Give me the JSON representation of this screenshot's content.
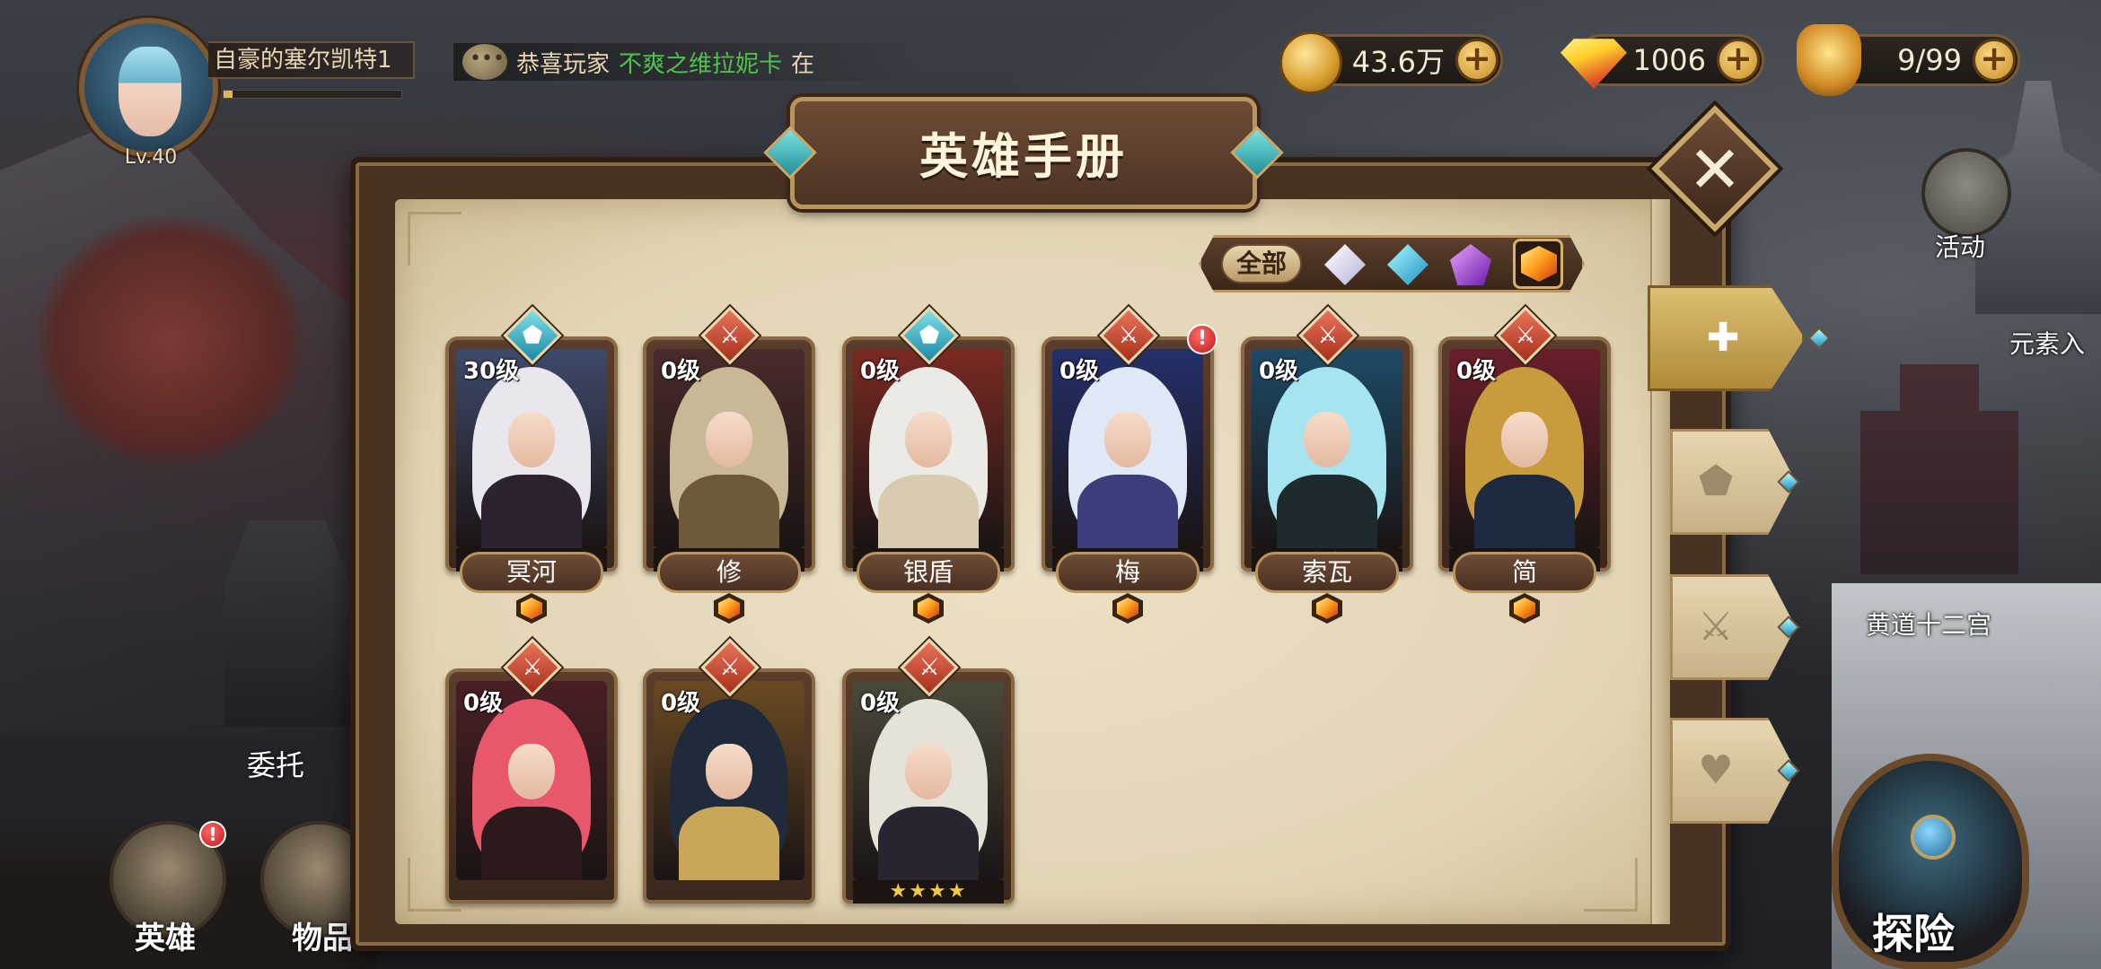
{
  "player": {
    "name": "自豪的塞尔凯特1",
    "level": "Lv.40",
    "exp_fraction": 0.05
  },
  "ticker": {
    "prefix": "恭喜玩家",
    "player": "不爽之维拉妮卡",
    "suffix": "在"
  },
  "currencies": {
    "gold": "43.6万",
    "gems": "1006",
    "stamina": "9/99"
  },
  "dialog": {
    "title": "英雄手册",
    "filter_all": "全部",
    "close_glyph": "✕"
  },
  "filters": [
    "white-gem",
    "cyan-gem",
    "purple-gem",
    "orange-gem"
  ],
  "side_tabs": [
    {
      "icon": "grid-icon",
      "glyph": "✚",
      "active": true
    },
    {
      "icon": "shield-icon",
      "glyph": "⬟",
      "active": false
    },
    {
      "icon": "sword-icon",
      "glyph": "⚔",
      "active": false
    },
    {
      "icon": "heart-icon",
      "glyph": "♥",
      "active": false
    }
  ],
  "heroes": [
    {
      "name": "冥河",
      "level": "30级",
      "role": "tank",
      "stars": "",
      "alert": false,
      "hair": "#e9e6ee",
      "body": "#2c2230",
      "bg": "#3e4a6a"
    },
    {
      "name": "修",
      "level": "0级",
      "role": "dps",
      "stars": "",
      "alert": false,
      "hair": "#c9b896",
      "body": "#6e5a3a",
      "bg": "#4a2a2a"
    },
    {
      "name": "银盾",
      "level": "0级",
      "role": "tank",
      "stars": "",
      "alert": false,
      "hair": "#eceae4",
      "body": "#d9cbb0",
      "bg": "#7a2a22"
    },
    {
      "name": "梅",
      "level": "0级",
      "role": "dps",
      "stars": "",
      "alert": true,
      "hair": "#dfe9f6",
      "body": "#3a3e7a",
      "bg": "#24306a"
    },
    {
      "name": "索瓦",
      "level": "0级",
      "role": "dps",
      "stars": "★★",
      "alert": false,
      "hair": "#a6e4f0",
      "body": "#1d2a2e",
      "bg": "#1d4a66"
    },
    {
      "name": "简",
      "level": "0级",
      "role": "dps",
      "stars": "★★",
      "alert": false,
      "hair": "#c89b3c",
      "body": "#1e2a40",
      "bg": "#6a1f2a"
    },
    {
      "name": "",
      "level": "0级",
      "role": "dps",
      "stars": "",
      "alert": false,
      "hair": "#e8576b",
      "body": "#2a1a1a",
      "bg": "#4a1f24"
    },
    {
      "name": "",
      "level": "0级",
      "role": "dps",
      "stars": "",
      "alert": false,
      "hair": "#1f2a3a",
      "body": "#caa65a",
      "bg": "#6a4a22"
    },
    {
      "name": "",
      "level": "0级",
      "role": "dps",
      "stars": "★★★★",
      "alert": false,
      "hair": "#e6e2d8",
      "body": "#2a2430",
      "bg": "#4a4a3a"
    }
  ],
  "world": {
    "activity": "活动",
    "element": "元素入",
    "zodiac": "黄道十二宫",
    "entrust": "委托",
    "explore": "探险"
  },
  "nav": {
    "heroes": "英雄",
    "items": "物品",
    "heroes_alert": "!"
  }
}
